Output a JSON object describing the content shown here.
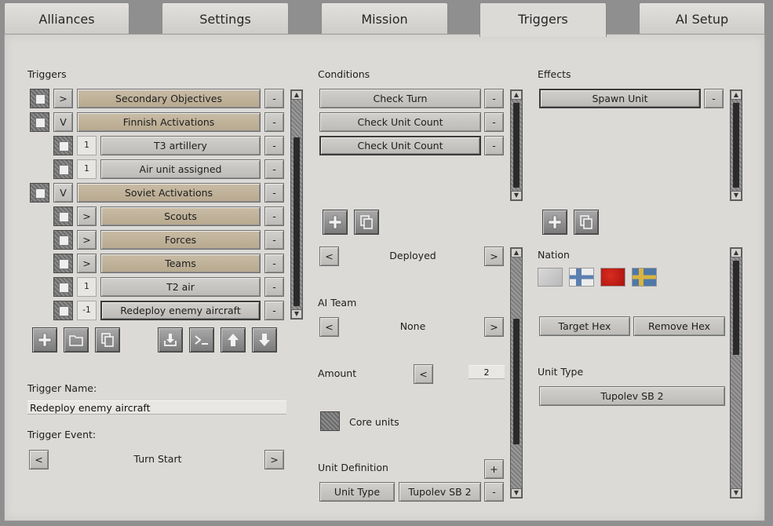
{
  "tabs": [
    {
      "label": "Alliances",
      "active": false
    },
    {
      "label": "Settings",
      "active": false
    },
    {
      "label": "Mission",
      "active": false
    },
    {
      "label": "Triggers",
      "active": true
    },
    {
      "label": "AI Setup",
      "active": false
    }
  ],
  "triggers": {
    "header": "Triggers",
    "rows": [
      {
        "indent": 0,
        "prefix": ">",
        "label": "Secondary Objectives",
        "remove": "-"
      },
      {
        "indent": 0,
        "prefix": "V",
        "label": "Finnish Activations",
        "remove": "-"
      },
      {
        "indent": 1,
        "prefix": "1",
        "label": "T3 artillery",
        "remove": "-"
      },
      {
        "indent": 1,
        "prefix": "1",
        "label": "Air unit assigned",
        "remove": "-"
      },
      {
        "indent": 0,
        "prefix": "V",
        "label": "Soviet Activations",
        "remove": "-"
      },
      {
        "indent": 1,
        "prefix": ">",
        "label": "Scouts",
        "remove": "-"
      },
      {
        "indent": 1,
        "prefix": ">",
        "label": "Forces",
        "remove": "-"
      },
      {
        "indent": 1,
        "prefix": ">",
        "label": "Teams",
        "remove": "-"
      },
      {
        "indent": 1,
        "prefix": "1",
        "label": "T2 air",
        "remove": "-"
      },
      {
        "indent": 1,
        "prefix": "-1",
        "label": "Redeploy enemy aircraft",
        "remove": "-"
      }
    ],
    "toolbar_icons": [
      "plus-icon",
      "folder-icon",
      "copy-icon",
      "import-icon",
      "console-icon",
      "arrow-up-icon",
      "arrow-down-icon"
    ],
    "name_label": "Trigger Name:",
    "name_value": "Redeploy enemy aircraft",
    "event_label": "Trigger Event:",
    "event_value": "Turn Start",
    "prev": "<",
    "next": ">"
  },
  "conditions": {
    "header": "Conditions",
    "items": [
      "Check Turn",
      "Check Unit Count",
      "Check Unit Count"
    ],
    "remove": "-",
    "deployed_value": "Deployed",
    "ai_team_label": "AI Team",
    "ai_team_value": "None",
    "amount_label": "Amount",
    "amount_value": "2",
    "core_units_label": "Core units",
    "unit_def_label": "Unit Definition",
    "unit_def_add": "+",
    "unit_type_btn": "Unit Type",
    "unit_type_value": "Tupolev SB 2",
    "prev": "<",
    "next": ">"
  },
  "effects": {
    "header": "Effects",
    "items": [
      "Spawn Unit"
    ],
    "remove": "-",
    "nation_label": "Nation",
    "target_hex": "Target Hex",
    "remove_hex": "Remove Hex",
    "unit_type_label": "Unit Type",
    "unit_type_value": "Tupolev SB 2"
  },
  "colors": {
    "tan": "#c2b49b",
    "panel": "#dcdad7",
    "button": "#c6c4c1"
  }
}
